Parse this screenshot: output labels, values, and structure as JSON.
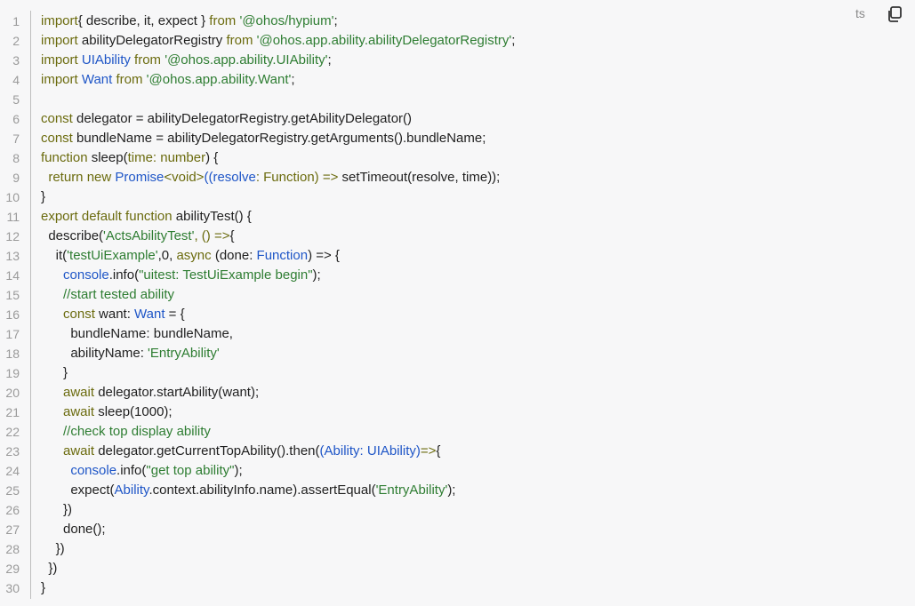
{
  "language_label": "ts",
  "copy_icon": "copy-icon",
  "lines": [
    {
      "n": "1",
      "segs": [
        [
          "kw",
          "import"
        ],
        [
          "",
          "{ describe, it, expect } "
        ],
        [
          "kw",
          "from"
        ],
        [
          "str",
          " '@ohos/hypium'"
        ],
        [
          "",
          ";"
        ]
      ]
    },
    {
      "n": "2",
      "segs": [
        [
          "kw",
          "import"
        ],
        [
          "",
          " abilityDelegatorRegistry "
        ],
        [
          "kw",
          "from"
        ],
        [
          "str",
          " '@ohos.app.ability.abilityDelegatorRegistry'"
        ],
        [
          "",
          ";"
        ]
      ]
    },
    {
      "n": "3",
      "segs": [
        [
          "kw",
          "import"
        ],
        [
          "typ",
          " UIAbility"
        ],
        [
          "kw",
          " from"
        ],
        [
          "str",
          " '@ohos.app.ability.UIAbility'"
        ],
        [
          "",
          ";"
        ]
      ]
    },
    {
      "n": "4",
      "segs": [
        [
          "kw",
          "import"
        ],
        [
          "typ",
          " Want"
        ],
        [
          "kw",
          " from"
        ],
        [
          "str",
          " '@ohos.app.ability.Want'"
        ],
        [
          "",
          ";"
        ]
      ]
    },
    {
      "n": "5",
      "segs": [
        [
          "",
          ""
        ]
      ]
    },
    {
      "n": "6",
      "segs": [
        [
          "kw",
          "const"
        ],
        [
          "",
          " delegator = abilityDelegatorRegistry.getAbilityDelegator()"
        ]
      ]
    },
    {
      "n": "7",
      "segs": [
        [
          "kw",
          "const"
        ],
        [
          "",
          " bundleName = abilityDelegatorRegistry.getArguments().bundleName;"
        ]
      ]
    },
    {
      "n": "8",
      "segs": [
        [
          "kw",
          "function"
        ],
        [
          "",
          " sleep("
        ],
        [
          "kw",
          "time: number"
        ],
        [
          "",
          ") {"
        ]
      ]
    },
    {
      "n": "9",
      "segs": [
        [
          "",
          "  "
        ],
        [
          "kw",
          "return new "
        ],
        [
          "typ",
          "Promise"
        ],
        [
          "kw",
          "<void>"
        ],
        [
          "typ",
          "((resolve"
        ],
        [
          "kw",
          ": Function) => "
        ],
        [
          "",
          "setTimeout(resolve, time));"
        ]
      ]
    },
    {
      "n": "10",
      "segs": [
        [
          "",
          "}"
        ]
      ]
    },
    {
      "n": "11",
      "segs": [
        [
          "kw",
          "export default function"
        ],
        [
          "",
          " abilityTest() {"
        ]
      ]
    },
    {
      "n": "12",
      "segs": [
        [
          "",
          "  describe("
        ],
        [
          "str",
          "'ActsAbilityTest'"
        ],
        [
          "kw",
          ", () =>"
        ],
        [
          "",
          "{"
        ]
      ]
    },
    {
      "n": "13",
      "segs": [
        [
          "",
          "    it("
        ],
        [
          "str",
          "'testUiExample'"
        ],
        [
          "",
          ",0, "
        ],
        [
          "kw",
          "async"
        ],
        [
          "",
          " (done: "
        ],
        [
          "typ",
          "Function"
        ],
        [
          "",
          ") => {"
        ]
      ]
    },
    {
      "n": "14",
      "segs": [
        [
          "typ",
          "      console"
        ],
        [
          "",
          ".info("
        ],
        [
          "str",
          "\"uitest: TestUiExample begin\""
        ],
        [
          "",
          ");"
        ]
      ]
    },
    {
      "n": "15",
      "segs": [
        [
          "cm",
          "      //start tested ability"
        ]
      ]
    },
    {
      "n": "16",
      "segs": [
        [
          "kw",
          "      const"
        ],
        [
          "",
          " want: "
        ],
        [
          "typ",
          "Want"
        ],
        [
          "",
          " = {"
        ]
      ]
    },
    {
      "n": "17",
      "segs": [
        [
          "",
          "        bundleName: bundleName,"
        ]
      ]
    },
    {
      "n": "18",
      "segs": [
        [
          "",
          "        abilityName: "
        ],
        [
          "str",
          "'EntryAbility'"
        ]
      ]
    },
    {
      "n": "19",
      "segs": [
        [
          "",
          "      }"
        ]
      ]
    },
    {
      "n": "20",
      "segs": [
        [
          "kw",
          "      await"
        ],
        [
          "",
          " delegator.startAbility(want);"
        ]
      ]
    },
    {
      "n": "21",
      "segs": [
        [
          "kw",
          "      await"
        ],
        [
          "",
          " sleep(1000);"
        ]
      ]
    },
    {
      "n": "22",
      "segs": [
        [
          "cm",
          "      //check top display ability"
        ]
      ]
    },
    {
      "n": "23",
      "segs": [
        [
          "kw",
          "      await"
        ],
        [
          "",
          " delegator.getCurrentTopAbility().then("
        ],
        [
          "typ",
          "(Ability: UIAbility)"
        ],
        [
          "kw",
          "=>"
        ],
        [
          "",
          "{"
        ]
      ]
    },
    {
      "n": "24",
      "segs": [
        [
          "typ",
          "        console"
        ],
        [
          "",
          ".info("
        ],
        [
          "str",
          "\"get top ability\""
        ],
        [
          "",
          ");"
        ]
      ]
    },
    {
      "n": "25",
      "segs": [
        [
          "",
          "        expect("
        ],
        [
          "typ",
          "Ability"
        ],
        [
          "",
          ".context.abilityInfo.name).assertEqual("
        ],
        [
          "str",
          "'EntryAbility'"
        ],
        [
          "",
          ");"
        ]
      ]
    },
    {
      "n": "26",
      "segs": [
        [
          "",
          "      })"
        ]
      ]
    },
    {
      "n": "27",
      "segs": [
        [
          "",
          "      done();"
        ]
      ]
    },
    {
      "n": "28",
      "segs": [
        [
          "",
          "    })"
        ]
      ]
    },
    {
      "n": "29",
      "segs": [
        [
          "",
          "  })"
        ]
      ]
    },
    {
      "n": "30",
      "segs": [
        [
          "",
          "}"
        ]
      ]
    }
  ]
}
